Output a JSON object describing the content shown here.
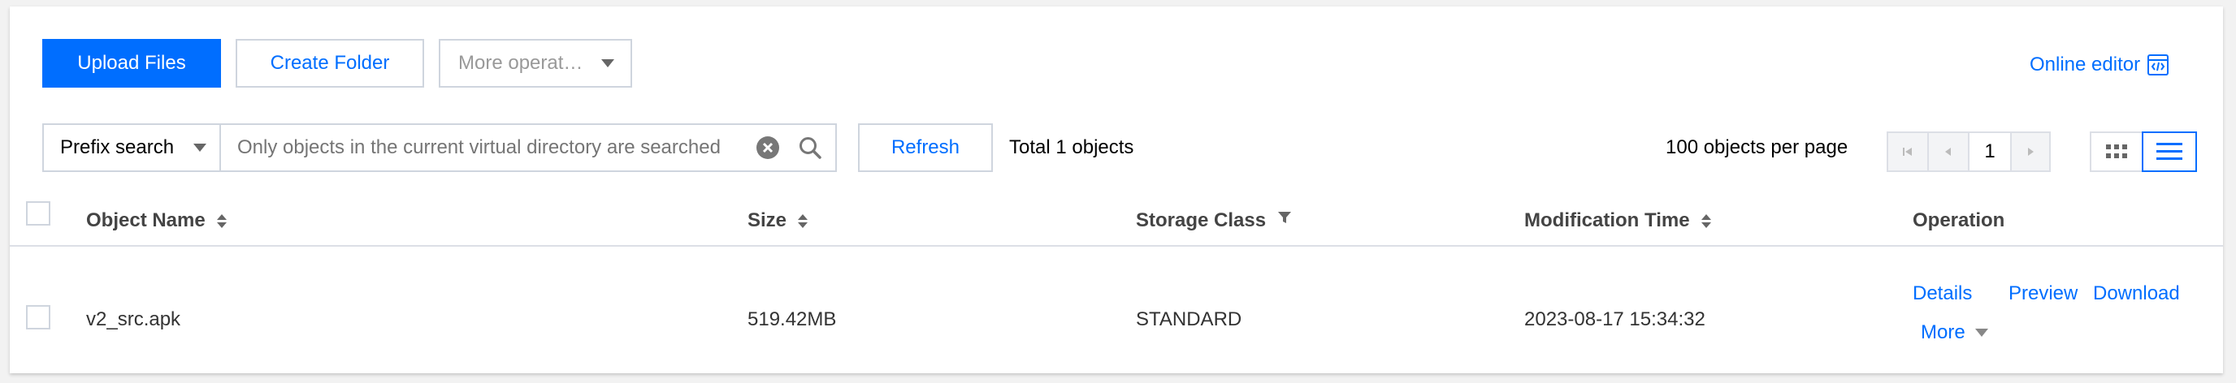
{
  "toolbar": {
    "upload_label": "Upload Files",
    "create_folder_label": "Create Folder",
    "more_operations_label": "More operat…",
    "online_editor_label": "Online editor"
  },
  "search": {
    "mode_label": "Prefix search",
    "placeholder": "Only objects in the current virtual directory are searched",
    "value": ""
  },
  "status": {
    "refresh_label": "Refresh",
    "total_label": "Total 1 objects",
    "per_page_label": "100 objects per page",
    "current_page": "1"
  },
  "table": {
    "headers": {
      "name": "Object Name",
      "size": "Size",
      "storage_class": "Storage Class",
      "modified": "Modification Time",
      "operation": "Operation"
    },
    "rows": [
      {
        "name": "v2_src.apk",
        "size": "519.42MB",
        "storage_class": "STANDARD",
        "modified": "2023-08-17 15:34:32",
        "ops": {
          "details": "Details",
          "preview": "Preview",
          "download": "Download",
          "more": "More"
        }
      }
    ]
  },
  "colors": {
    "accent": "#006eff",
    "border": "#cfd5de",
    "text": "#000000"
  }
}
